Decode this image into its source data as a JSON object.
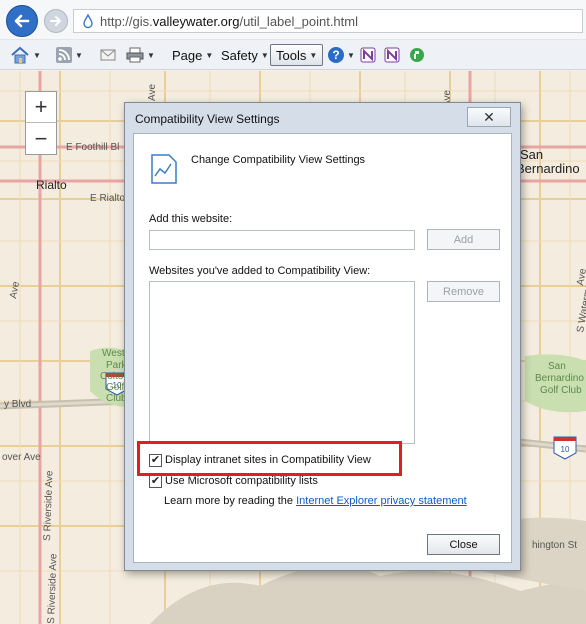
{
  "browser": {
    "url_host": "http://gis.",
    "url_domain": "valleywater.org",
    "url_path": "/util_label_point.html",
    "page_label": "Page",
    "safety_label": "Safety",
    "tools_label": "Tools",
    "help_glyph": "?"
  },
  "map": {
    "zoom_in": "+",
    "zoom_out": "−",
    "labels": [
      "E Foothill Bl",
      "Rialto",
      "E Rialto A",
      "San",
      "Bernardino",
      "West",
      "Park",
      "Colton",
      "Golf",
      "Club",
      "y Blvd",
      "10",
      "over Ave",
      "10",
      "S Riverside Ave",
      "S Riverside Ave",
      "San",
      "Bernardino",
      "Golf Club",
      "S Waterman Ave",
      "hington St",
      "Ave",
      "Ave",
      "Ave",
      "Ave"
    ]
  },
  "dialog": {
    "title": "Compatibility View Settings",
    "close_glyph": "✕",
    "header_text": "Change Compatibility View Settings",
    "add_website_label": "Add this website:",
    "add_website_value": "",
    "add_button": "Add",
    "list_label": "Websites you've added to Compatibility View:",
    "list_items": [],
    "remove_button": "Remove",
    "checkbox_intranet": "Display intranet sites in Compatibility View",
    "checkbox_ms_lists": "Use Microsoft compatibility lists",
    "learn_more_prefix": "Learn more by reading the ",
    "learn_more_link": "Internet Explorer privacy statement",
    "close_button": "Close",
    "intranet_checked": true,
    "ms_lists_checked": true,
    "check_glyph": "✔"
  },
  "colors": {
    "highlight": "#e02020",
    "link": "#0b5cc8",
    "accent": "#2f6fc7"
  }
}
